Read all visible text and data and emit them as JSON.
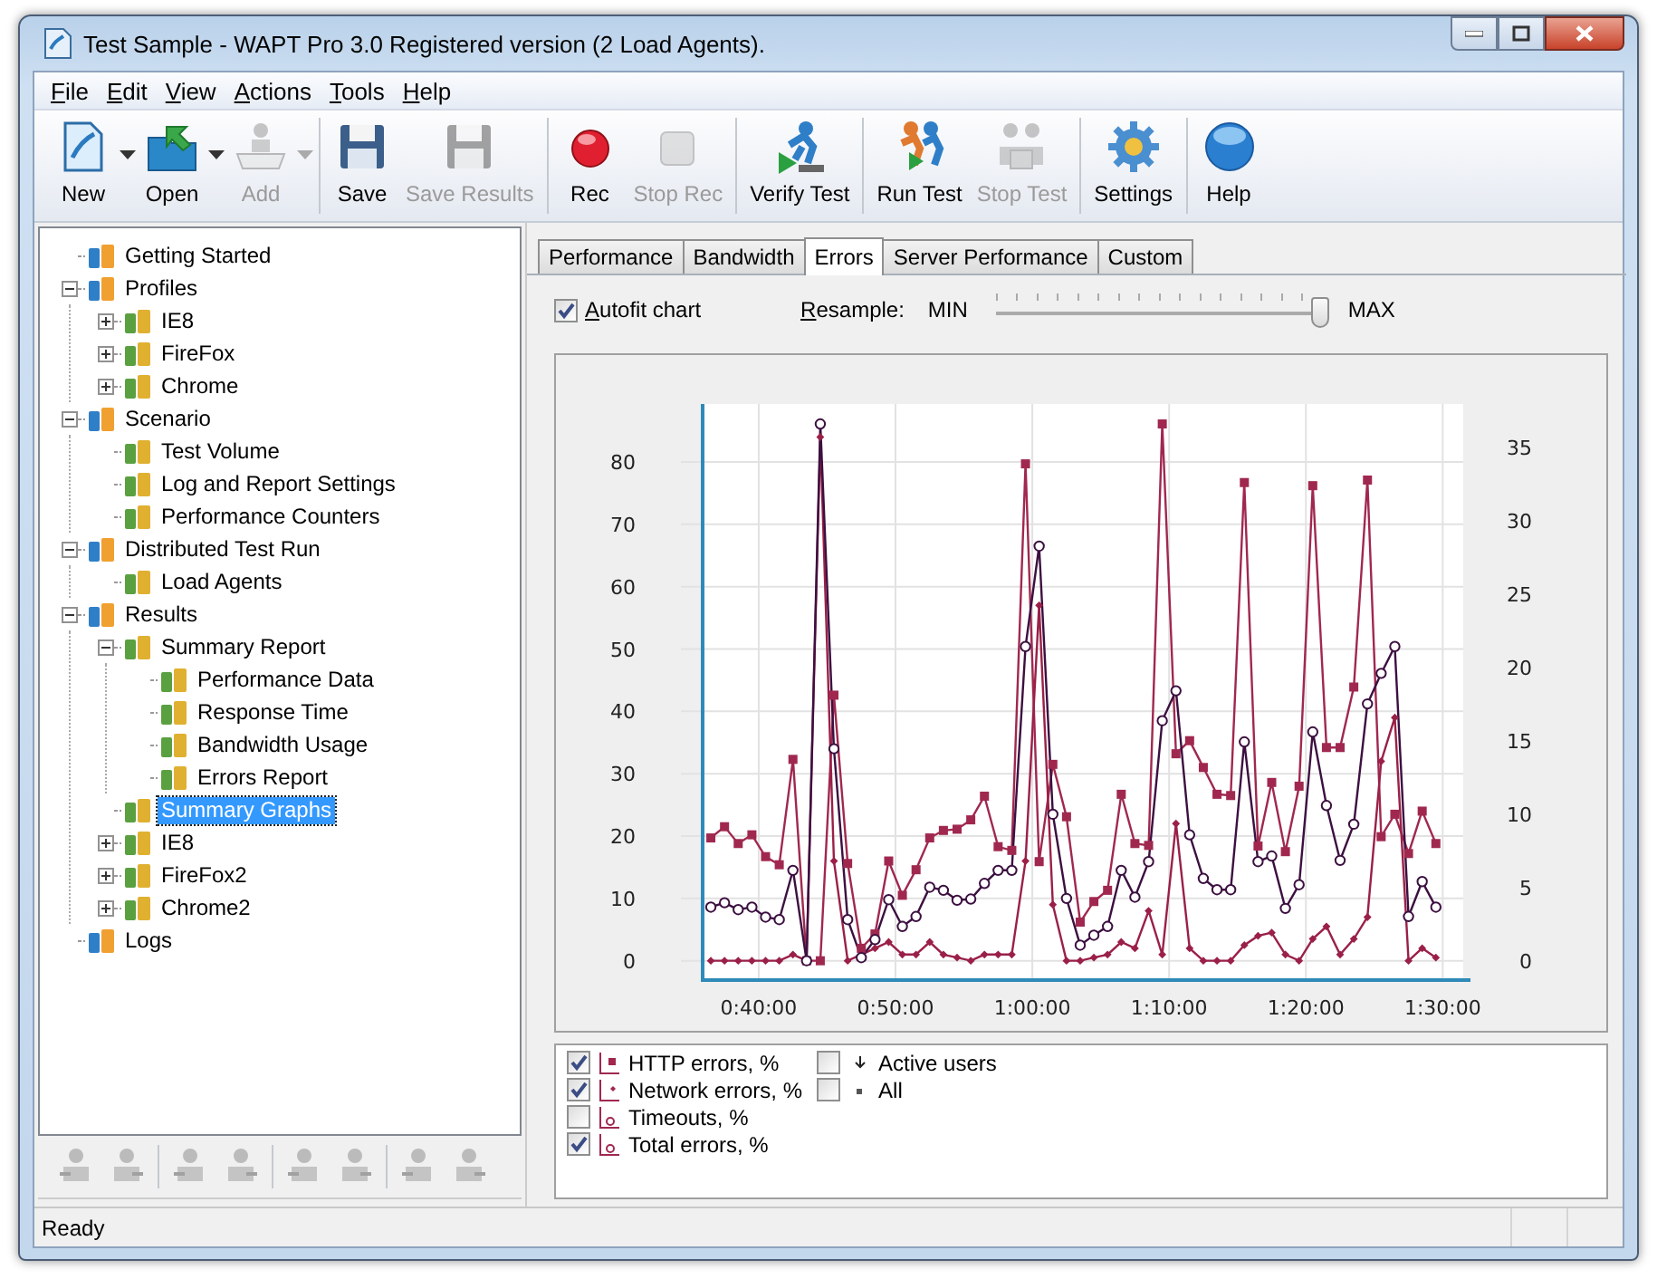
{
  "window": {
    "title": "Test Sample - WAPT Pro 3.0 Registered version (2 Load Agents)."
  },
  "menu": [
    "File",
    "Edit",
    "View",
    "Actions",
    "Tools",
    "Help"
  ],
  "toolbar": [
    [
      {
        "label": "New",
        "disabled": false,
        "dropdown": true
      },
      {
        "label": "Open",
        "disabled": false,
        "dropdown": true
      },
      {
        "label": "Add",
        "disabled": true,
        "dropdown": true
      }
    ],
    [
      {
        "label": "Save",
        "disabled": false,
        "dropdown": false
      },
      {
        "label": "Save Results",
        "disabled": true,
        "dropdown": false
      }
    ],
    [
      {
        "label": "Rec",
        "disabled": false,
        "dropdown": false
      },
      {
        "label": "Stop Rec",
        "disabled": true,
        "dropdown": false
      }
    ],
    [
      {
        "label": "Verify Test",
        "disabled": false,
        "dropdown": false
      }
    ],
    [
      {
        "label": "Run Test",
        "disabled": false,
        "dropdown": false
      },
      {
        "label": "Stop Test",
        "disabled": true,
        "dropdown": false
      }
    ],
    [
      {
        "label": "Settings",
        "disabled": false,
        "dropdown": false
      }
    ],
    [
      {
        "label": "Help",
        "disabled": false,
        "dropdown": false
      }
    ]
  ],
  "tree": [
    {
      "label": "Getting Started",
      "selected": false
    },
    {
      "label": "Profiles",
      "selected": false,
      "expanded": true,
      "children": [
        {
          "label": "IE8",
          "selected": false,
          "expanded": false
        },
        {
          "label": "FireFox",
          "selected": false,
          "expanded": false
        },
        {
          "label": "Chrome",
          "selected": false,
          "expanded": false
        }
      ]
    },
    {
      "label": "Scenario",
      "selected": false,
      "expanded": true,
      "children": [
        {
          "label": "Test Volume",
          "selected": false
        },
        {
          "label": "Log and Report Settings",
          "selected": false
        },
        {
          "label": "Performance Counters",
          "selected": false
        }
      ]
    },
    {
      "label": "Distributed Test Run",
      "selected": false,
      "expanded": true,
      "children": [
        {
          "label": "Load Agents",
          "selected": false
        }
      ]
    },
    {
      "label": "Results",
      "selected": false,
      "expanded": true,
      "children": [
        {
          "label": "Summary Report",
          "selected": false,
          "expanded": true,
          "children": [
            {
              "label": "Performance Data",
              "selected": false
            },
            {
              "label": "Response Time",
              "selected": false
            },
            {
              "label": "Bandwidth Usage",
              "selected": false
            },
            {
              "label": "Errors Report",
              "selected": false
            }
          ]
        },
        {
          "label": "Summary Graphs",
          "selected": true
        },
        {
          "label": "IE8",
          "selected": false,
          "expanded": false
        },
        {
          "label": "FireFox2",
          "selected": false,
          "expanded": false
        },
        {
          "label": "Chrome2",
          "selected": false,
          "expanded": false
        }
      ]
    },
    {
      "label": "Logs",
      "selected": false
    }
  ],
  "panel_toolbar": [
    [
      {
        "disabled": true
      },
      {
        "disabled": true
      }
    ],
    [
      {
        "disabled": true
      },
      {
        "disabled": true
      }
    ],
    [
      {
        "disabled": true
      },
      {
        "disabled": true
      }
    ],
    [
      {
        "disabled": true
      },
      {
        "disabled": true
      }
    ]
  ],
  "tabs": [
    {
      "label": "Performance",
      "selected": false
    },
    {
      "label": "Bandwidth",
      "selected": false
    },
    {
      "label": "Errors",
      "selected": true
    },
    {
      "label": "Server Performance",
      "selected": false
    },
    {
      "label": "Custom",
      "selected": false
    }
  ],
  "options": {
    "autofit": {
      "label": "Autofit chart",
      "checked": true
    },
    "resample": {
      "label": "Resample:",
      "min_label": "MIN",
      "max_label": "MAX",
      "level": 0.99
    }
  },
  "chart": {
    "right_axis_ticks": [
      "35",
      "30",
      "25",
      "20",
      "15",
      "10",
      "5",
      "0"
    ],
    "chart_data": {
      "type": "line",
      "grid": true,
      "xlim": [
        35.9,
        91.5
      ],
      "ylim": [
        -3.1,
        89.3
      ],
      "xticks": [
        {
          "value": 40,
          "label": "0:40:00"
        },
        {
          "value": 50,
          "label": "0:50:00"
        },
        {
          "value": 60,
          "label": "1:00:00"
        },
        {
          "value": 70,
          "label": "1:10:00"
        },
        {
          "value": 80,
          "label": "1:20:00"
        },
        {
          "value": 90,
          "label": "1:30:00"
        }
      ],
      "yticks": [
        0,
        10,
        20,
        30,
        40,
        50,
        60,
        70,
        80
      ],
      "x": [
        36.5,
        37.5,
        38.5,
        39.5,
        40.5,
        41.5,
        42.5,
        43.5,
        44.5,
        45.5,
        46.5,
        47.5,
        48.5,
        49.5,
        50.5,
        51.5,
        52.5,
        53.5,
        54.5,
        55.5,
        56.5,
        57.5,
        58.5,
        59.5,
        60.5,
        61.5,
        62.5,
        63.5,
        64.5,
        65.5,
        66.5,
        67.5,
        68.5,
        69.5,
        70.5,
        71.5,
        72.5,
        73.5,
        74.5,
        75.5,
        76.5,
        77.5,
        78.5,
        79.5,
        80.5,
        81.5,
        82.5,
        83.5,
        84.5,
        85.5,
        86.5,
        87.5,
        88.5,
        89.5
      ],
      "series": [
        {
          "marker": "square",
          "color": "#a0284f",
          "values": [
            19.7,
            21.5,
            18.8,
            20.2,
            16.7,
            15.4,
            32.3,
            0,
            0,
            42.6,
            15.6,
            2,
            4.3,
            16,
            10.5,
            14.6,
            19.7,
            20.9,
            21.1,
            22.6,
            26.4,
            18.3,
            17.7,
            79.7,
            15.9,
            31.5,
            23.1,
            6.2,
            9.5,
            11.3,
            26.7,
            18.8,
            18.5,
            86.1,
            33.2,
            35.3,
            31,
            26.7,
            26.5,
            76.7,
            18.4,
            28.6,
            17.5,
            28,
            76.2,
            34.2,
            34.2,
            43.9,
            77.1,
            19.9,
            23.5,
            17.2,
            24,
            18.8
          ]
        },
        {
          "marker": "diamond",
          "color": "#9a2048",
          "values": [
            0,
            0,
            0,
            0,
            0,
            0,
            1,
            0,
            84,
            16,
            0,
            1,
            2,
            3,
            1,
            1,
            3,
            1,
            0.5,
            0,
            1,
            1,
            1,
            16,
            57,
            9,
            0,
            0,
            0.5,
            1,
            3,
            2,
            8,
            1,
            22,
            2,
            0,
            0,
            0,
            2.5,
            4,
            4.5,
            1,
            0,
            3.5,
            5.5,
            1,
            3.5,
            7,
            32,
            39,
            0,
            2,
            0.5
          ]
        },
        {
          "marker": "circle",
          "color": "#3c1040",
          "values": [
            8.6,
            9.3,
            8.2,
            8.6,
            7,
            6.6,
            14.5,
            0,
            86.1,
            34,
            6.6,
            0.5,
            3.4,
            9.8,
            5.5,
            7.1,
            11.8,
            11.3,
            9.7,
            9.9,
            12.4,
            14.5,
            14.5,
            50.4,
            66.5,
            23.5,
            10,
            2.5,
            4.1,
            5.5,
            14.5,
            10.2,
            15.9,
            38.5,
            43.3,
            20.2,
            13.2,
            11.4,
            11.4,
            35.1,
            15.9,
            16.8,
            8.4,
            12.2,
            36.7,
            24.9,
            16.1,
            21.9,
            41.2,
            46.1,
            50.4,
            7.1,
            12.7,
            8.6
          ]
        }
      ]
    }
  },
  "legend": [
    [
      {
        "label": "HTTP errors, %",
        "checked": true,
        "kind": "square"
      },
      {
        "label": "Network errors, %",
        "checked": true,
        "kind": "diamond"
      },
      {
        "label": "Timeouts, %",
        "checked": false,
        "kind": "circle"
      },
      {
        "label": "Total errors, %",
        "checked": true,
        "kind": "circle"
      }
    ],
    [
      {
        "label": "Active users",
        "checked": false,
        "kind": "arrow"
      },
      {
        "label": "All",
        "checked": false,
        "kind": "dot"
      }
    ]
  ],
  "status_bar": {
    "text": "Ready"
  }
}
